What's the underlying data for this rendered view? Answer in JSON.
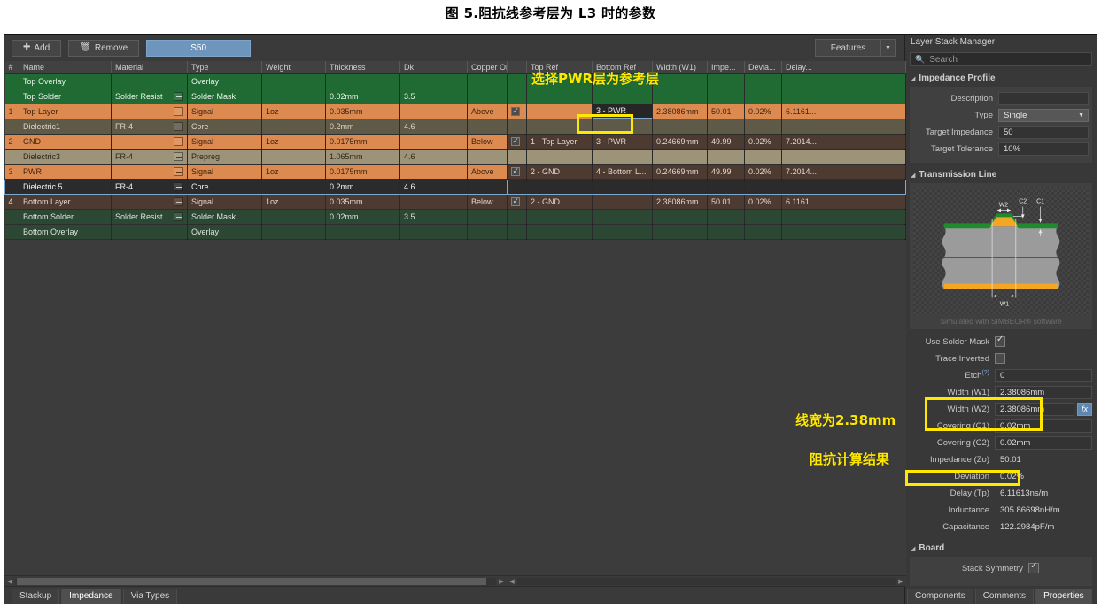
{
  "caption": "图 5.阻抗线参考层为 L3 时的参数",
  "toolbar": {
    "add_label": "Add",
    "add_icon": "plus-icon",
    "remove_label": "Remove",
    "remove_icon": "trash-icon",
    "profile_label": "S50",
    "features_label": "Features",
    "features_arrow_icon": "chevron-down-icon"
  },
  "stackup_table": {
    "columns": [
      "#",
      "Name",
      "Material",
      "Type",
      "Weight",
      "Thickness",
      "Dk",
      "Copper Orie"
    ],
    "rows": [
      {
        "num": "",
        "name": "Top Overlay",
        "material": "",
        "type": "Overlay",
        "weight": "",
        "thickness": "",
        "dk": "",
        "orient": "",
        "style": "r-overlay",
        "mat_box": false
      },
      {
        "num": "",
        "name": "Top Solder",
        "material": "Solder Resist",
        "type": "Solder Mask",
        "weight": "",
        "thickness": "0.02mm",
        "dk": "3.5",
        "orient": "",
        "style": "r-solder",
        "mat_box": true
      },
      {
        "num": "1",
        "name": "Top Layer",
        "material": "",
        "type": "Signal",
        "weight": "1oz",
        "thickness": "0.035mm",
        "dk": "",
        "orient": "Above",
        "style": "r-signal",
        "mat_box": true
      },
      {
        "num": "",
        "name": "Dielectric1",
        "material": "FR-4",
        "type": "Core",
        "weight": "",
        "thickness": "0.2mm",
        "dk": "4.6",
        "orient": "",
        "style": "r-core-dk",
        "mat_box": true
      },
      {
        "num": "2",
        "name": "GND",
        "material": "",
        "type": "Signal",
        "weight": "1oz",
        "thickness": "0.0175mm",
        "dk": "",
        "orient": "Below",
        "style": "r-signal",
        "mat_box": true
      },
      {
        "num": "",
        "name": "Dielectric3",
        "material": "FR-4",
        "type": "Prepreg",
        "weight": "",
        "thickness": "1.065mm",
        "dk": "4.6",
        "orient": "",
        "style": "r-prepreg",
        "mat_box": true
      },
      {
        "num": "3",
        "name": "PWR",
        "material": "",
        "type": "Signal",
        "weight": "1oz",
        "thickness": "0.0175mm",
        "dk": "",
        "orient": "Above",
        "style": "r-signal",
        "mat_box": true
      },
      {
        "num": "",
        "name": "Dielectric 5",
        "material": "FR-4",
        "type": "Core",
        "weight": "",
        "thickness": "0.2mm",
        "dk": "4.6",
        "orient": "",
        "style": "selected",
        "mat_box": true
      },
      {
        "num": "4",
        "name": "Bottom Layer",
        "material": "",
        "type": "Signal",
        "weight": "1oz",
        "thickness": "0.035mm",
        "dk": "",
        "orient": "Below",
        "style": "r-bottom",
        "mat_box": true
      },
      {
        "num": "",
        "name": "Bottom Solder",
        "material": "Solder Resist",
        "type": "Solder Mask",
        "weight": "",
        "thickness": "0.02mm",
        "dk": "3.5",
        "orient": "",
        "style": "r-overlay2",
        "mat_box": true
      },
      {
        "num": "",
        "name": "Bottom Overlay",
        "material": "",
        "type": "Overlay",
        "weight": "",
        "thickness": "",
        "dk": "",
        "orient": "",
        "style": "r-overlay2",
        "mat_box": false
      }
    ]
  },
  "impedance_table": {
    "columns": [
      "",
      "Top Ref",
      "Bottom Ref",
      "Width (W1)",
      "Impe...",
      "Devia...",
      "Delay..."
    ],
    "rows": [
      {
        "checked": false,
        "top_ref": "",
        "bottom_ref": "",
        "width": "",
        "imp": "",
        "dev": "",
        "delay": "",
        "style": "r-overlay",
        "kind": "blank"
      },
      {
        "checked": false,
        "top_ref": "",
        "bottom_ref": "",
        "width": "",
        "imp": "",
        "dev": "",
        "delay": "",
        "style": "r-solder",
        "kind": "blank"
      },
      {
        "checked": true,
        "top_ref": "",
        "bottom_ref": "3 - PWR",
        "width": "2.38086mm",
        "imp": "50.01",
        "dev": "0.02%",
        "delay": "6.1161...",
        "style": "r-signal",
        "kind": "edit"
      },
      {
        "checked": false,
        "top_ref": "",
        "bottom_ref": "",
        "width": "",
        "imp": "",
        "dev": "",
        "delay": "",
        "style": "r-core-dk",
        "kind": "blank"
      },
      {
        "checked": true,
        "top_ref": "1 - Top Layer",
        "bottom_ref": "3 - PWR",
        "width": "0.24669mm",
        "imp": "49.99",
        "dev": "0.02%",
        "delay": "7.2014...",
        "style": "r-signal-dark",
        "kind": "row"
      },
      {
        "checked": false,
        "top_ref": "",
        "bottom_ref": "",
        "width": "",
        "imp": "",
        "dev": "",
        "delay": "",
        "style": "r-prepreg",
        "kind": "blank"
      },
      {
        "checked": true,
        "top_ref": "2 - GND",
        "bottom_ref": "4 - Bottom L...",
        "width": "0.24669mm",
        "imp": "49.99",
        "dev": "0.02%",
        "delay": "7.2014...",
        "style": "r-signal-dark",
        "kind": "row"
      },
      {
        "checked": false,
        "top_ref": "",
        "bottom_ref": "",
        "width": "",
        "imp": "",
        "dev": "",
        "delay": "",
        "style": "selected",
        "kind": "blank"
      },
      {
        "checked": true,
        "top_ref": "2 - GND",
        "bottom_ref": "",
        "width": "2.38086mm",
        "imp": "50.01",
        "dev": "0.02%",
        "delay": "6.1161...",
        "style": "r-bottom",
        "kind": "row"
      },
      {
        "checked": false,
        "top_ref": "",
        "bottom_ref": "",
        "width": "",
        "imp": "",
        "dev": "",
        "delay": "",
        "style": "r-overlay2",
        "kind": "blank"
      },
      {
        "checked": false,
        "top_ref": "",
        "bottom_ref": "",
        "width": "",
        "imp": "",
        "dev": "",
        "delay": "",
        "style": "r-overlay2",
        "kind": "blank"
      }
    ]
  },
  "bottom_tabs": {
    "items": [
      {
        "label": "Stackup",
        "active": false
      },
      {
        "label": "Impedance",
        "active": true
      },
      {
        "label": "Via Types",
        "active": false
      }
    ]
  },
  "panel": {
    "title": "Layer Stack Manager",
    "search_placeholder": "Search",
    "search_icon": "search-icon",
    "impedance_profile": {
      "header": "Impedance Profile",
      "description_label": "Description",
      "description_value": "",
      "type_label": "Type",
      "type_value": "Single",
      "target_impedance_label": "Target Impedance",
      "target_impedance_value": "50",
      "target_tolerance_label": "Target Tolerance",
      "target_tolerance_value": "10%"
    },
    "transmission_line": {
      "header": "Transmission Line",
      "diagram_labels": [
        "W2",
        "C2",
        "C1",
        "W1"
      ],
      "simulated_note": "Simulated with SIMBEOR® software",
      "use_solder_mask_label": "Use Solder Mask",
      "use_solder_mask_checked": true,
      "trace_inverted_label": "Trace Inverted",
      "trace_inverted_checked": false,
      "etch_label": "Etch",
      "etch_sup": "(?)",
      "etch_value": "0",
      "width_w1_label": "Width (W1)",
      "width_w1_value": "2.38086mm",
      "width_w2_label": "Width (W2)",
      "width_w2_value": "2.38086mm",
      "fx_label": "fx",
      "covering_c1_label": "Covering (C1)",
      "covering_c1_value": "0.02mm",
      "covering_c2_label": "Covering (C2)",
      "covering_c2_value": "0.02mm",
      "impedance_zo_label": "Impedance (Zo)",
      "impedance_zo_value": "50.01",
      "deviation_label": "Deviation",
      "deviation_value": "0.02%",
      "delay_tp_label": "Delay (Tp)",
      "delay_tp_value": "6.11613ns/m",
      "inductance_label": "Inductance",
      "inductance_value": "305.86698nH/m",
      "capacitance_label": "Capacitance",
      "capacitance_value": "122.2984pF/m"
    },
    "board": {
      "header": "Board",
      "stack_symmetry_label": "Stack Symmetry",
      "stack_symmetry_checked": true
    },
    "doc_tabs": [
      {
        "label": "Components",
        "active": false
      },
      {
        "label": "Comments",
        "active": false
      },
      {
        "label": "Properties",
        "active": true
      }
    ]
  },
  "annotations": {
    "pwr_ref": "选择PWR层为参考层",
    "width": "线宽为2.38mm",
    "impedance_result": "阻抗计算结果",
    "accent_color": "#ffe800"
  }
}
